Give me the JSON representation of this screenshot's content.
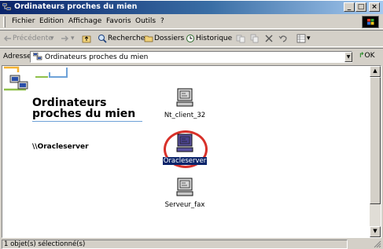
{
  "window": {
    "title": "Ordinateurs proches du mien"
  },
  "title_buttons": {
    "minimize": "_",
    "maximize": "□",
    "close": "×"
  },
  "menu": {
    "items": [
      {
        "label": "Fichier"
      },
      {
        "label": "Edition"
      },
      {
        "label": "Affichage"
      },
      {
        "label": "Favoris"
      },
      {
        "label": "Outils"
      },
      {
        "label": "?"
      }
    ]
  },
  "toolbar": {
    "back": "Précédente",
    "search": "Rechercher",
    "folders": "Dossiers",
    "history": "Historique"
  },
  "address": {
    "label": "Adresse",
    "value": "Ordinateurs proches du mien",
    "go": "OK"
  },
  "panel": {
    "title": "Ordinateurs proches du mien",
    "server": "\\\\Oracleserver"
  },
  "computers": [
    {
      "name": "Nt_client_32",
      "selected": false
    },
    {
      "name": "Oracleserver",
      "selected": true
    },
    {
      "name": "Serveur_fax",
      "selected": false
    }
  ],
  "status": {
    "text": "1 objet(s) sélectionné(s)"
  },
  "colors": {
    "titlebar": "#0a246a",
    "selection": "#0a246a",
    "highlight_ring": "#d8312a",
    "panel_accent": "#6ea2d8"
  }
}
